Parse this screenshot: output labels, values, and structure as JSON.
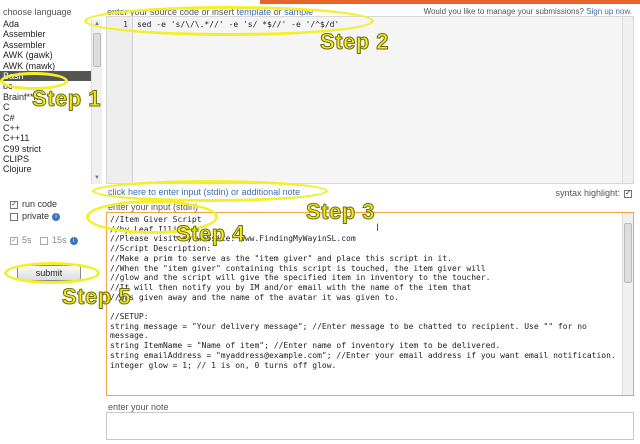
{
  "languages": {
    "label": "choose language",
    "items": [
      "Ada",
      "Assembler",
      "Assembler",
      "AWK (gawk)",
      "AWK (mawk)",
      "Bash",
      "bc",
      "Brainf**k",
      "C",
      "C#",
      "C++",
      "C++11",
      "C99 strict",
      "CLIPS",
      "Clojure"
    ],
    "selected": "Bash"
  },
  "source": {
    "label_prefix": "enter your source code or insert ",
    "template_link": "template",
    "or": " or ",
    "sample_link": "sample",
    "line_number": "1",
    "code": "sed -e 's/\\/\\.*//' -e 's/ *$//' -e '/^$/d'"
  },
  "header": {
    "manage_text": "Would you like to manage your submissions?",
    "signup_link": "Sign up now."
  },
  "stdin_link": "click here to enter input (stdin) or additional note",
  "syntax_highlight": {
    "label": "syntax highlight:",
    "checked": true
  },
  "options": {
    "run_code": {
      "label": "run code",
      "checked": true
    },
    "private": {
      "label": "private",
      "checked": false
    },
    "time_5s": {
      "label": "5s",
      "checked": true
    },
    "time_15s": {
      "label": "15s",
      "checked": false
    }
  },
  "submit_label": "submit",
  "input": {
    "label": "enter your input (stdin)",
    "text": "//Item Giver Script\n//by Leaf Illi\n//Please visit my website: www.FindingMyWayinSL.com\n//Script Description:\n//Make a prim to serve as the \"item giver\" and place this script in it.\n//When the \"item giver\" containing this script is touched, the item giver will\n//glow and the script will give the specified item in inventory to the toucher.\n//It will then notify you by IM and/or email with the name of the item that\n//was given away and the name of the avatar it was given to.\n\n//SETUP:\nstring message = \"Your delivery message\"; //Enter message to be chatted to recipient. Use \"\" for no message.\nstring ItemName = \"Name of item\"; //Enter name of inventory item to be delivered.\nstring emailAddress = \"myaddress@example.com\"; //Enter your email address if you want email notification.\ninteger glow = 1; // 1 is on, 0 turns off glow."
  },
  "note": {
    "label": "enter your note"
  },
  "annotations": {
    "step1": "Step 1",
    "step2": "Step 2",
    "step3": "Step 3",
    "step4": "Step 4",
    "step5": "Step 5",
    "color": "#f3ef2a"
  },
  "colors": {
    "accent": "#e8632a",
    "link": "#3b6cb4",
    "input_border": "#f2a344"
  }
}
